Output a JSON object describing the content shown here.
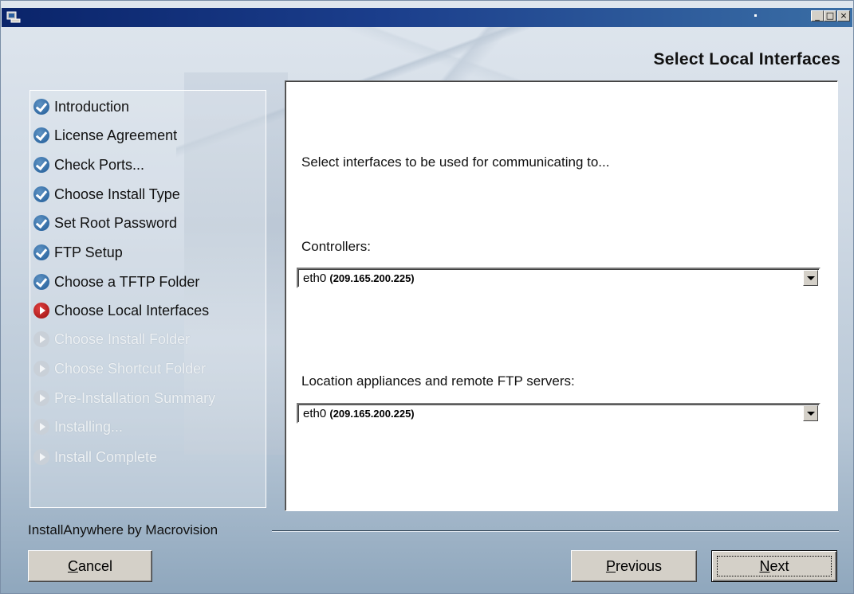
{
  "window": {
    "title": "",
    "buttons": {
      "minimize": "_",
      "maximize": "□",
      "close": "×"
    }
  },
  "header": {
    "title": "Select Local Interfaces"
  },
  "steps": [
    {
      "label": "Introduction",
      "state": "done"
    },
    {
      "label": "License Agreement",
      "state": "done"
    },
    {
      "label": "Check Ports...",
      "state": "done"
    },
    {
      "label": "Choose Install Type",
      "state": "done"
    },
    {
      "label": "Set Root Password",
      "state": "done"
    },
    {
      "label": "FTP Setup",
      "state": "done"
    },
    {
      "label": "Choose a TFTP Folder",
      "state": "done"
    },
    {
      "label": "Choose Local Interfaces",
      "state": "current"
    },
    {
      "label": "Choose Install Folder",
      "state": "todo"
    },
    {
      "label": "Choose Shortcut Folder",
      "state": "todo"
    },
    {
      "label": "Pre-Installation Summary",
      "state": "todo"
    },
    {
      "label": "Installing...",
      "state": "todo"
    },
    {
      "label": "Install Complete",
      "state": "todo"
    }
  ],
  "content": {
    "intro": "Select interfaces to be used for communicating to...",
    "controllers": {
      "label": "Controllers:",
      "iface": "eth0",
      "ip": "(209.165.200.225)"
    },
    "location": {
      "label": "Location appliances and remote FTP servers:",
      "iface": "eth0",
      "ip": "(209.165.200.225)"
    }
  },
  "footer": {
    "brand": "InstallAnywhere by Macrovision",
    "cancel": {
      "accel": "C",
      "rest": "ancel"
    },
    "previous": {
      "accel": "P",
      "rest": "revious"
    },
    "next": {
      "accel": "N",
      "rest": "ext"
    }
  }
}
